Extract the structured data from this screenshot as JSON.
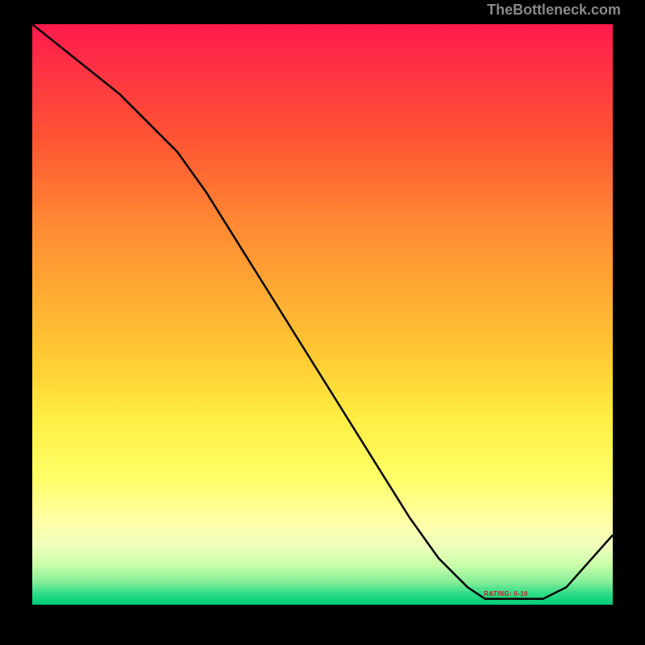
{
  "watermark": "TheBottleneck.com",
  "band_label": "RATING: 0-10",
  "chart_data": {
    "type": "line",
    "title": "",
    "xlabel": "",
    "ylabel": "",
    "xlim": [
      0,
      100
    ],
    "ylim": [
      0,
      100
    ],
    "x": [
      0,
      5,
      10,
      15,
      20,
      25,
      30,
      35,
      40,
      45,
      50,
      55,
      60,
      65,
      70,
      75,
      78,
      80,
      85,
      88,
      92,
      100
    ],
    "values": [
      100,
      96,
      92,
      88,
      83,
      78,
      71,
      63,
      55,
      47,
      39,
      31,
      23,
      15,
      8,
      3,
      1,
      1,
      1,
      1,
      3,
      12
    ],
    "gradient_bands": [
      {
        "pct": 0,
        "color": "#ff1a4d"
      },
      {
        "pct": 8,
        "color": "#ff3344"
      },
      {
        "pct": 20,
        "color": "#ff5533"
      },
      {
        "pct": 34,
        "color": "#ff8833"
      },
      {
        "pct": 46,
        "color": "#ffaa33"
      },
      {
        "pct": 58,
        "color": "#ffcc33"
      },
      {
        "pct": 68,
        "color": "#ffee44"
      },
      {
        "pct": 78,
        "color": "#ffff66"
      },
      {
        "pct": 86,
        "color": "#ffffaa"
      },
      {
        "pct": 90,
        "color": "#eeffbb"
      },
      {
        "pct": 93,
        "color": "#ccffaa"
      },
      {
        "pct": 96,
        "color": "#88ee99"
      },
      {
        "pct": 98,
        "color": "#33dd88"
      },
      {
        "pct": 100,
        "color": "#00cc77"
      }
    ]
  }
}
